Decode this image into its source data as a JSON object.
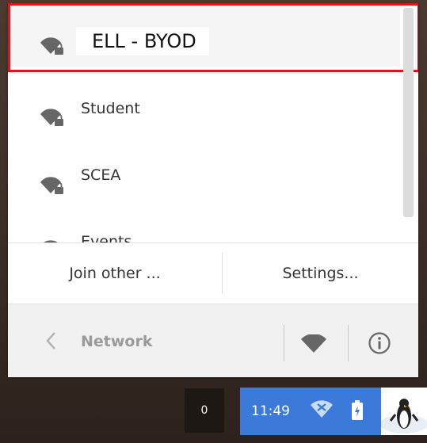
{
  "networks": [
    {
      "name": "ELL - BYOD",
      "secured": true,
      "selected": true
    },
    {
      "name": "Student",
      "secured": true,
      "selected": false
    },
    {
      "name": "SCEA",
      "secured": true,
      "selected": false
    },
    {
      "name": "Events",
      "secured": true,
      "selected": false
    }
  ],
  "actions": {
    "join_other": "Join other ...",
    "settings": "Settings..."
  },
  "footer": {
    "title": "Network"
  },
  "shelf": {
    "notification_count": "0",
    "time": "11:49"
  },
  "colors": {
    "highlight": "#e0141e",
    "status_area": "#3b7ad8",
    "icon_gray": "#666666"
  },
  "icons": [
    "wifi-lock-icon",
    "back-chevron-icon",
    "wifi-icon",
    "info-icon",
    "wifi-disconnected-icon",
    "battery-charging-icon"
  ]
}
